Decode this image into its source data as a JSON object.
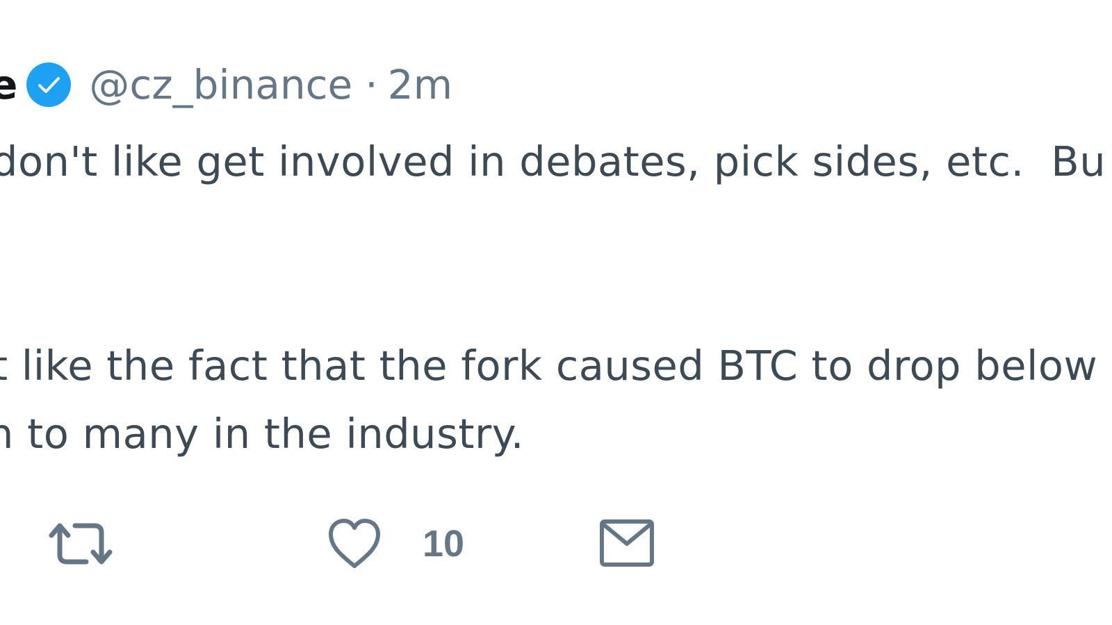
{
  "tweet": {
    "display_name": "e",
    "verified": true,
    "handle": "@cz_binance",
    "separator": "·",
    "time": "2m",
    "lines": [
      "don't like get involved in debates, pick sides, etc.  Bu",
      "t like the fact that the fork caused BTC to drop below",
      "n to many in the industry."
    ]
  },
  "actions": {
    "retweet_icon": "retweet-icon",
    "like_icon": "heart-icon",
    "like_count": "10",
    "dm_icon": "envelope-icon"
  },
  "colors": {
    "verified_blue": "#1da1f2",
    "secondary_text": "#657786",
    "body_text": "#3b4a55",
    "name_text": "#14171a"
  }
}
